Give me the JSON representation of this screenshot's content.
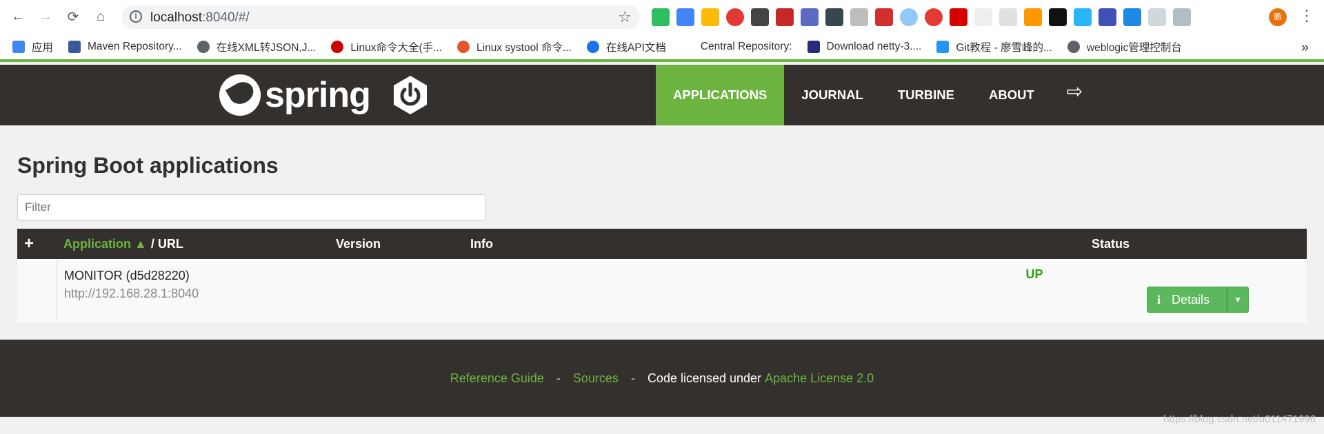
{
  "browser": {
    "url_host": "localhost",
    "url_rest": ":8040/#/",
    "profile_initial": "鹏"
  },
  "bookmarks": [
    {
      "label": "应用",
      "icon": "apps-grid-icon",
      "color": "#4285f4"
    },
    {
      "label": "Maven Repository...",
      "icon": "mvn-icon",
      "color": "#3b5998"
    },
    {
      "label": "在线XML转JSON,J...",
      "icon": "globe-icon",
      "color": "#5f6368"
    },
    {
      "label": "Linux命令大全(手...",
      "icon": "redhat-icon",
      "color": "#cc0000"
    },
    {
      "label": "Linux systool 命令...",
      "icon": "flame-icon",
      "color": "#e2572b"
    },
    {
      "label": "在线API文档",
      "icon": "c-icon",
      "color": "#1a73e8"
    },
    {
      "label": "Central Repository:",
      "icon": "",
      "color": ""
    },
    {
      "label": "Download netty-3....",
      "icon": "book-icon",
      "color": "#2a2a7a"
    },
    {
      "label": "Git教程 - 廖雪峰的...",
      "icon": "rocket-icon",
      "color": "#2196f3"
    },
    {
      "label": "weblogic管理控制台",
      "icon": "globe-icon",
      "color": "#5f6368"
    }
  ],
  "brand": {
    "name": "spring",
    "accent": "#6db33f",
    "dark": "#34302d"
  },
  "nav": {
    "items": [
      "APPLICATIONS",
      "JOURNAL",
      "TURBINE",
      "ABOUT"
    ],
    "active": "APPLICATIONS"
  },
  "main": {
    "title": "Spring Boot applications",
    "filter_placeholder": "Filter"
  },
  "table": {
    "add": "+",
    "col_app": "Application ▲",
    "col_url": "/ URL",
    "col_version": "Version",
    "col_info": "Info",
    "col_status": "Status",
    "rows": [
      {
        "name": "MONITOR (d5d28220)",
        "url": "http://192.168.28.1:8040",
        "status": "UP",
        "details_label": "Details"
      }
    ]
  },
  "footer": {
    "reference": "Reference Guide",
    "sep": "-",
    "sources": "Sources",
    "licensed": "Code licensed under",
    "license": "Apache License 2.0"
  },
  "watermark": "https://blog.csdn.net/u011471996"
}
